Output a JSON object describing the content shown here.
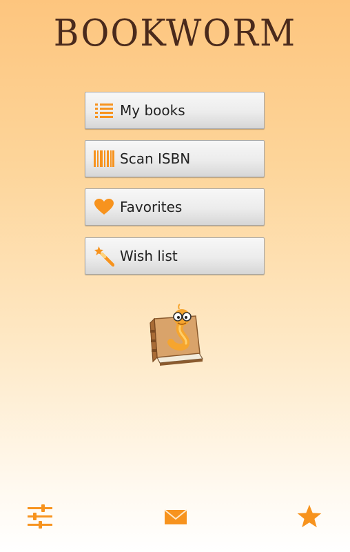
{
  "app": {
    "title": "BOOKWORM"
  },
  "menu": {
    "items": [
      {
        "label": "My books",
        "icon": "list-icon"
      },
      {
        "label": "Scan ISBN",
        "icon": "barcode-icon"
      },
      {
        "label": "Favorites",
        "icon": "heart-icon"
      },
      {
        "label": "Wish list",
        "icon": "magic-wand-icon"
      }
    ]
  },
  "bottom_bar": {
    "items": [
      {
        "icon": "sliders-icon"
      },
      {
        "icon": "envelope-icon"
      },
      {
        "icon": "star-icon"
      }
    ]
  },
  "colors": {
    "accent": "#f7931e",
    "title": "#4a2a1c",
    "background_top": "#fdc57e",
    "background_bottom": "#ffffff"
  }
}
